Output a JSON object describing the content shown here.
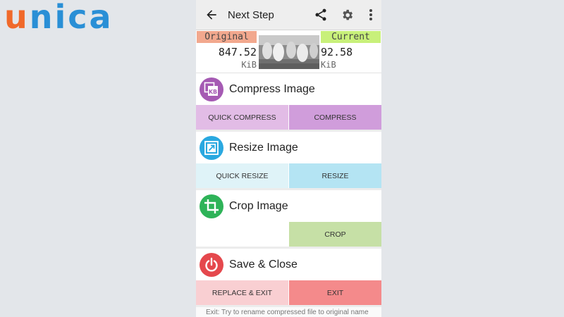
{
  "brand": {
    "logo_first": "u",
    "logo_rest": "nica"
  },
  "appbar": {
    "title": "Next Step",
    "icons": [
      "back-arrow-icon",
      "share-icon",
      "gear-icon",
      "more-vert-icon"
    ]
  },
  "sizes": {
    "original_label": "Original",
    "original_value": "847.52",
    "original_unit": "KiB",
    "current_label": "Current",
    "current_value": "92.58",
    "current_unit": "KiB"
  },
  "sections": {
    "compress": {
      "title": "Compress Image",
      "icon": "kb-compress-icon",
      "color": "#a55ab3",
      "quick": "QUICK COMPRESS",
      "main": "COMPRESS",
      "quick_bg": "#e2bce6",
      "main_bg": "#d09ddb"
    },
    "resize": {
      "title": "Resize Image",
      "icon": "resize-icon",
      "color": "#29a8e0",
      "quick": "QUICK RESIZE",
      "main": "RESIZE",
      "quick_bg": "#dff3f8",
      "main_bg": "#b4e4f3"
    },
    "crop": {
      "title": "Crop Image",
      "icon": "crop-icon",
      "color": "#2eb358",
      "main": "CROP",
      "main_bg": "#c6e0a6"
    },
    "save": {
      "title": "Save & Close",
      "icon": "power-icon",
      "color": "#e5484d",
      "replace": "REPLACE & EXIT",
      "exit": "EXIT",
      "replace_bg": "#f9cfd2",
      "exit_bg": "#f48a8b"
    }
  },
  "footer_note": "Exit: Try to rename compressed file to original name"
}
